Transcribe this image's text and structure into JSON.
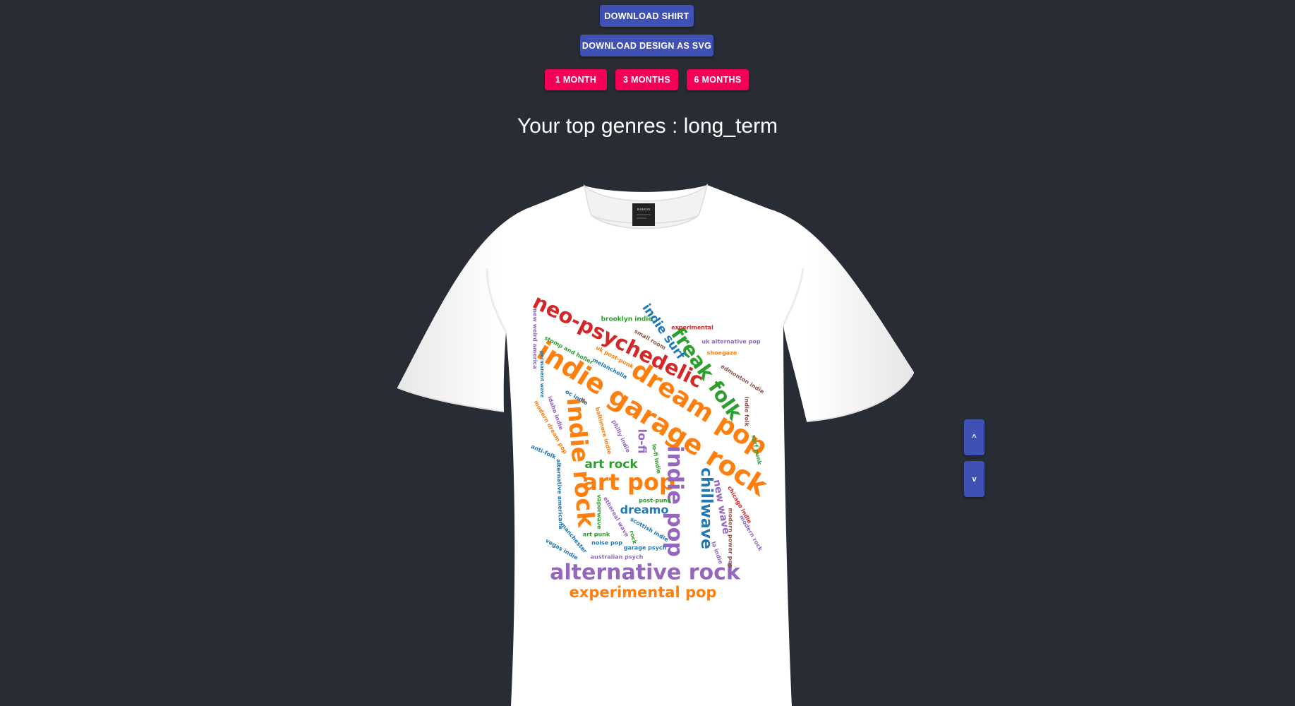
{
  "buttons": {
    "download_shirt": "DOWNLOAD SHIRT",
    "download_svg": "DOWNLOAD DESIGN AS SVG",
    "one_month": "1 MONTH",
    "three_months": "3 MONTHS",
    "six_months": "6 MONTHS"
  },
  "heading": "Your top genres : long_term",
  "shirt": {
    "label_text": "BARRON",
    "genres": [
      {
        "text": "neo-psychedelic",
        "color": "#d62728"
      },
      {
        "text": "indie garage rock",
        "color": "#ff7f0e"
      },
      {
        "text": "dream pop",
        "color": "#ff7f0e"
      },
      {
        "text": "freak folk",
        "color": "#2ca02c"
      },
      {
        "text": "indie surf",
        "color": "#1f77b4"
      },
      {
        "text": "indie rock",
        "color": "#ff7f0e"
      },
      {
        "text": "art pop",
        "color": "#ff7f0e"
      },
      {
        "text": "indie pop",
        "color": "#9467bd"
      },
      {
        "text": "chillwave",
        "color": "#1f77b4"
      },
      {
        "text": "alternative rock",
        "color": "#9467bd"
      },
      {
        "text": "experimental pop",
        "color": "#ff7f0e"
      },
      {
        "text": "art rock",
        "color": "#2ca02c"
      },
      {
        "text": "dreamo",
        "color": "#1f77b4"
      },
      {
        "text": "new wave",
        "color": "#9467bd"
      },
      {
        "text": "lo-fi",
        "color": "#9467bd"
      },
      {
        "text": "brooklyn indie",
        "color": "#2ca02c"
      },
      {
        "text": "experimental",
        "color": "#d62728"
      },
      {
        "text": "uk alternative pop",
        "color": "#9467bd"
      },
      {
        "text": "shoegaze",
        "color": "#ff7f0e"
      },
      {
        "text": "small room",
        "color": "#8c564b"
      },
      {
        "text": "stomp and holler",
        "color": "#2ca02c"
      },
      {
        "text": "uk post-punk",
        "color": "#ff7f0e"
      },
      {
        "text": "melancholia",
        "color": "#1f77b4"
      },
      {
        "text": "edmonton indie",
        "color": "#8c564b"
      },
      {
        "text": "indie folk",
        "color": "#8c564b"
      },
      {
        "text": "new weird america",
        "color": "#9467bd"
      },
      {
        "text": "permanent wave",
        "color": "#1f77b4"
      },
      {
        "text": "oc indie",
        "color": "#1f77b4"
      },
      {
        "text": "idaho indie",
        "color": "#9467bd"
      },
      {
        "text": "modern dream pop",
        "color": "#ff7f0e"
      },
      {
        "text": "baltimore indie",
        "color": "#ff7f0e"
      },
      {
        "text": "philly indie",
        "color": "#9467bd"
      },
      {
        "text": "lo-fi indie",
        "color": "#2ca02c"
      },
      {
        "text": "surf punk",
        "color": "#2ca02c"
      },
      {
        "text": "anti-folk",
        "color": "#1f77b4"
      },
      {
        "text": "alternative americana",
        "color": "#1f77b4"
      },
      {
        "text": "post-punk",
        "color": "#2ca02c"
      },
      {
        "text": "chicago indie",
        "color": "#d62728"
      },
      {
        "text": "modern rock",
        "color": "#9467bd"
      },
      {
        "text": "vaporwave",
        "color": "#2ca02c"
      },
      {
        "text": "ethereal wave",
        "color": "#9467bd"
      },
      {
        "text": "scottish indie",
        "color": "#1f77b4"
      },
      {
        "text": "modern power pop",
        "color": "#8c564b"
      },
      {
        "text": "la indie",
        "color": "#9467bd"
      },
      {
        "text": "manchester",
        "color": "#1f77b4"
      },
      {
        "text": "art punk",
        "color": "#2ca02c"
      },
      {
        "text": "rock",
        "color": "#2ca02c"
      },
      {
        "text": "noise pop",
        "color": "#1f77b4"
      },
      {
        "text": "garage psych",
        "color": "#1f77b4"
      },
      {
        "text": "vegas indie",
        "color": "#1f77b4"
      },
      {
        "text": "australian psych",
        "color": "#9467bd"
      }
    ]
  },
  "nav": {
    "up": "^",
    "down": "v"
  }
}
